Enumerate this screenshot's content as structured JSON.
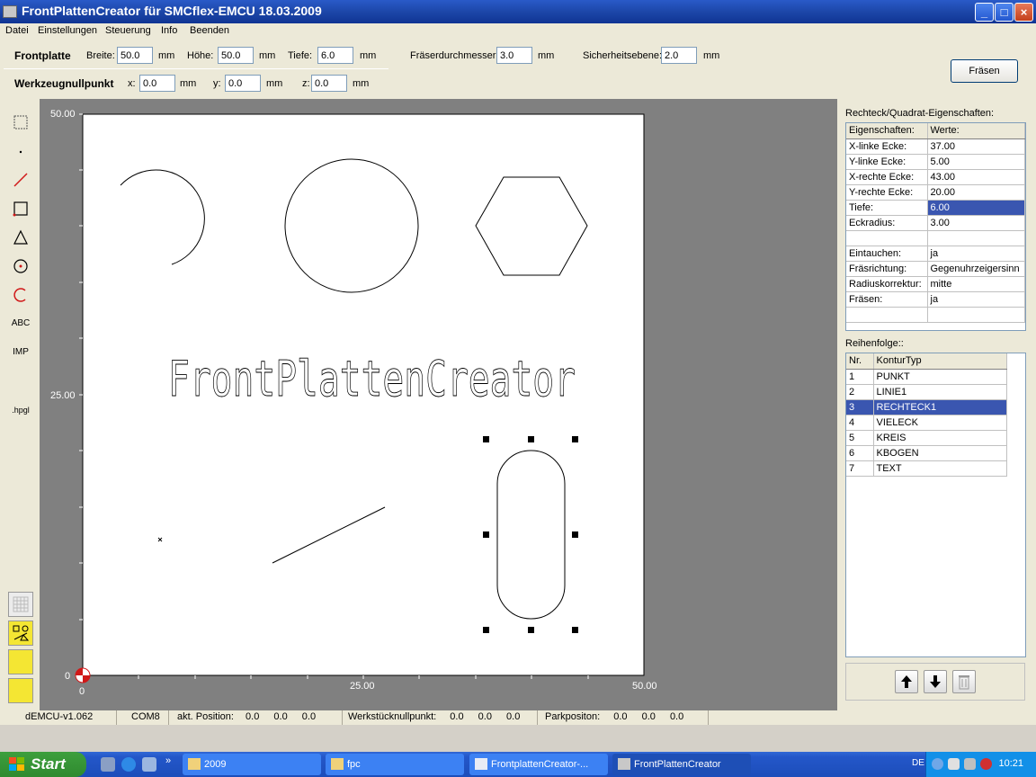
{
  "window": {
    "title": "FrontPlattenCreator für SMCflex-EMCU  18.03.2009",
    "minimize_label": "_",
    "maximize_label": "□",
    "close_label": "×"
  },
  "menu": {
    "items": [
      "Datei",
      "Einstellungen",
      "Steuerung",
      "Info",
      "Beenden"
    ]
  },
  "toolbar": {
    "frontplatte_label": "Frontplatte",
    "breite_label": "Breite:",
    "breite_value": "50.0",
    "hoehe_label": "Höhe:",
    "hoehe_value": "50.0",
    "tiefe_label": "Tiefe:",
    "tiefe_value": "6.0",
    "fraeser_label": "Fräserdurchmesser:",
    "fraeser_value": "3.0",
    "sicherheit_label": "Sicherheitsebene:",
    "sicherheit_value": "2.0",
    "unit": "mm",
    "werkzeug_label": "Werkzeugnullpunkt",
    "x_label": "x:",
    "x_value": "0.0",
    "y_label": "y:",
    "y_value": "0.0",
    "z_label": "z:",
    "z_value": "0.0",
    "fraesen_button": "Fräsen"
  },
  "tools": {
    "text_tool": "ABC",
    "import_tool": "IMP",
    "hpgl_tool": ".hpgl"
  },
  "canvas": {
    "axis_y_top": "50.00",
    "axis_y_mid": "25.00",
    "axis_y_zero": "0",
    "axis_x_zero": "0",
    "axis_x_mid": "25.00",
    "axis_x_end": "50.00",
    "plate_text": "FrontPlattenCreator"
  },
  "properties": {
    "title": "Rechteck/Quadrat-Eigenschaften:",
    "col_prop": "Eigenschaften:",
    "col_val": "Werte:",
    "rows": [
      {
        "prop": "X-linke Ecke:",
        "val": "37.00"
      },
      {
        "prop": "Y-linke Ecke:",
        "val": "5.00"
      },
      {
        "prop": "X-rechte Ecke:",
        "val": "43.00"
      },
      {
        "prop": "Y-rechte Ecke:",
        "val": "20.00"
      },
      {
        "prop": "Tiefe:",
        "val": "6.00"
      },
      {
        "prop": "Eckradius:",
        "val": "3.00"
      },
      {
        "prop": "",
        "val": ""
      },
      {
        "prop": "Eintauchen:",
        "val": "ja"
      },
      {
        "prop": "Fräsrichtung:",
        "val": "Gegenuhrzeigersinn"
      },
      {
        "prop": "Radiuskorrektur:",
        "val": "mitte"
      },
      {
        "prop": "Fräsen:",
        "val": "ja"
      },
      {
        "prop": "",
        "val": ""
      }
    ]
  },
  "sequence": {
    "title": "Reihenfolge::",
    "col_nr": "Nr.",
    "col_type": "KonturTyp",
    "rows": [
      {
        "nr": "1",
        "type": "PUNKT"
      },
      {
        "nr": "2",
        "type": "LINIE1"
      },
      {
        "nr": "3",
        "type": "RECHTECK1"
      },
      {
        "nr": "4",
        "type": "VIELECK"
      },
      {
        "nr": "5",
        "type": "KREIS"
      },
      {
        "nr": "6",
        "type": "KBOGEN"
      },
      {
        "nr": "7",
        "type": "TEXT"
      }
    ]
  },
  "status": {
    "version": "dEMCU-v1.062",
    "port": "COM8",
    "akt_label": "akt. Position:",
    "akt_x": "0.0",
    "akt_y": "0.0",
    "akt_z": "0.0",
    "werk_label": "Werkstücknullpunkt:",
    "werk_x": "0.0",
    "werk_y": "0.0",
    "werk_z": "0.0",
    "park_label": "Parkpositon:",
    "park_x": "0.0",
    "park_y": "0.0",
    "park_z": "0.0"
  },
  "taskbar": {
    "start": "Start",
    "more": "»",
    "tasks": [
      "2009",
      "fpc",
      "FrontplattenCreator-...",
      "FrontPlattenCreator"
    ],
    "lang": "DE",
    "clock": "10:21"
  }
}
